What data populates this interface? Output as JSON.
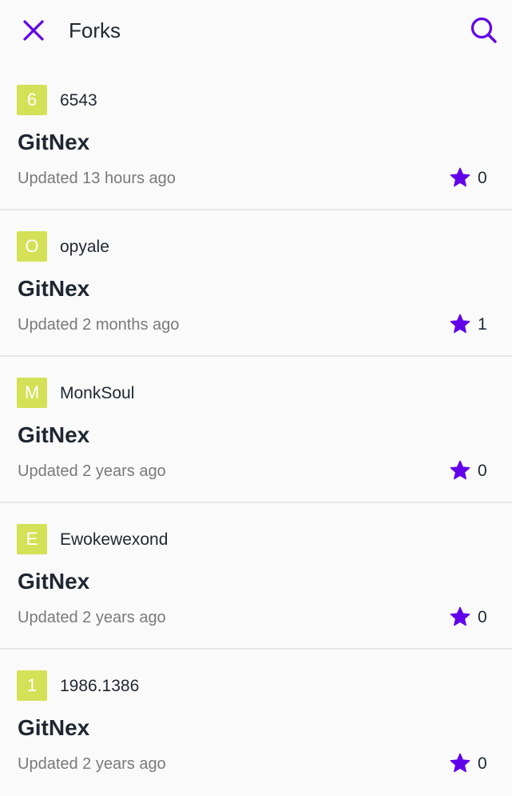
{
  "header": {
    "title": "Forks",
    "close_icon": "close-icon",
    "search_icon": "search-icon"
  },
  "colors": {
    "accent": "#6200ea",
    "avatar_bg": "#d4e157",
    "text_primary": "#1f2732",
    "text_secondary": "#7a7a7a",
    "background": "#fafafa",
    "divider": "#e6e6e6"
  },
  "forks": [
    {
      "initial": "6",
      "owner": "6543",
      "name": "GitNex",
      "updated": "Updated 13 hours ago",
      "stars": "0"
    },
    {
      "initial": "O",
      "owner": "opyale",
      "name": "GitNex",
      "updated": "Updated 2 months ago",
      "stars": "1"
    },
    {
      "initial": "M",
      "owner": "MonkSoul",
      "name": "GitNex",
      "updated": "Updated 2 years ago",
      "stars": "0"
    },
    {
      "initial": "E",
      "owner": "Ewokewexond",
      "name": "GitNex",
      "updated": "Updated 2 years ago",
      "stars": "0"
    },
    {
      "initial": "1",
      "owner": "1986.1386",
      "name": "GitNex",
      "updated": "Updated 2 years ago",
      "stars": "0"
    }
  ]
}
